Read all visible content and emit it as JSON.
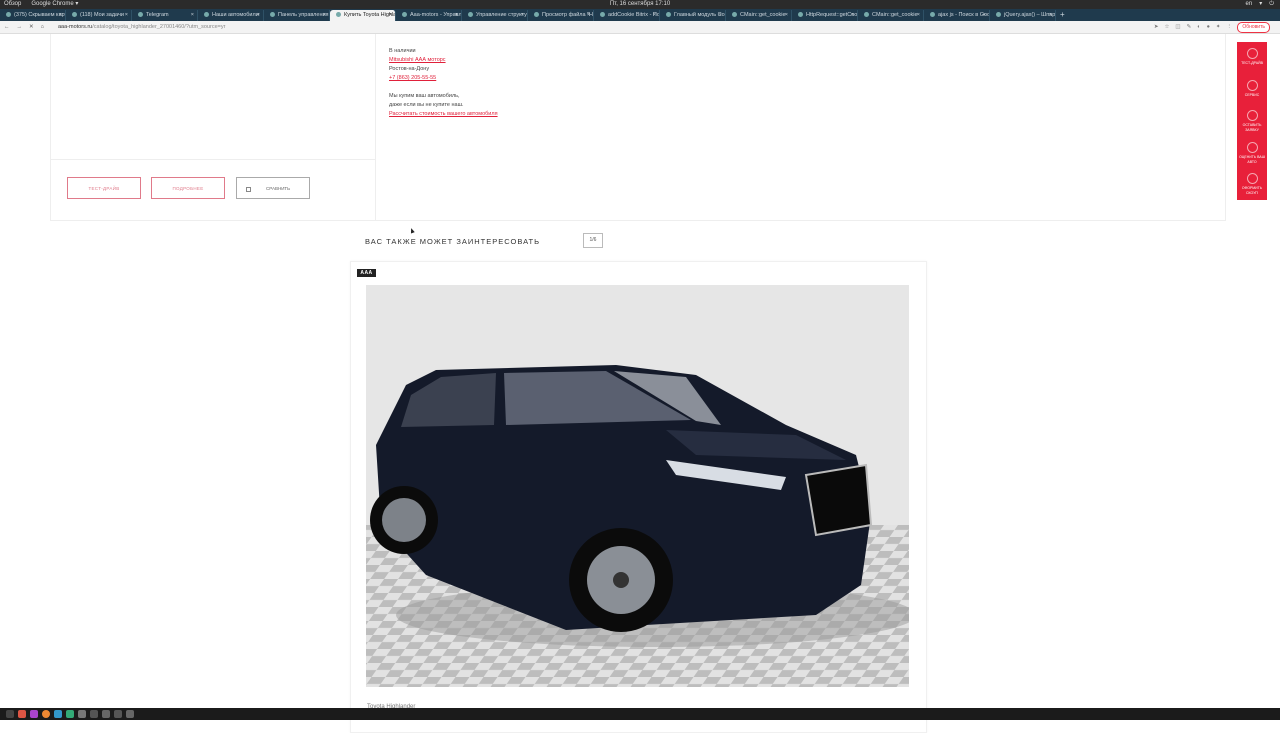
{
  "os": {
    "activities": "Обзор",
    "app": "Google Chrome ▾",
    "datetime": "Пт, 16 сентября 17:10",
    "lang": "en"
  },
  "tabs": [
    {
      "label": "(375) Скрываем карт..."
    },
    {
      "label": "(118) Мои задачи"
    },
    {
      "label": "Telegram"
    },
    {
      "label": "Наши автомобили"
    },
    {
      "label": "Панель управления"
    },
    {
      "label": "Купить Toyota Highlan...",
      "active": true
    },
    {
      "label": "Aaa-motors - Управле..."
    },
    {
      "label": "Управление структур..."
    },
    {
      "label": "Просмотр файла \"Но..."
    },
    {
      "label": "addCookie Bitrix - Пои..."
    },
    {
      "label": "Главный модуль Cont..."
    },
    {
      "label": "CMain::get_cookie"
    },
    {
      "label": "HttpRequest::getCoo..."
    },
    {
      "label": "CMain::get_cookie"
    },
    {
      "label": "ajax js - Поиск в Google"
    },
    {
      "label": "jQuery.ajax() – Шпарг..."
    }
  ],
  "address": {
    "host": "aaa-motors.ru",
    "path": "/catalog/toyota_highlander_27001460/?utm_source=yr",
    "refresh_label": "Обновить"
  },
  "info": {
    "availability": "В наличии",
    "dealer": "Mitsubishi ААА моторс",
    "city": "Ростов-на-Дону",
    "phone": "+7 (863) 205-55-55",
    "buy_line1": "Мы купим ваш автомобиль,",
    "buy_line2": "даже если вы не купите наш.",
    "calc_link": "Рассчитать стоимость вашего автомобиля"
  },
  "buttons": {
    "test_drive": "ТЕСТ-ДРАЙВ",
    "details": "ПОДРОБНЕЕ",
    "compare": "СРАВНИТЬ"
  },
  "sidebar": [
    {
      "label": "ТЕСТ-ДРАЙВ"
    },
    {
      "label": "СЕРВИС"
    },
    {
      "label": "ОСТАВИТЬ ЗАЯВКУ"
    },
    {
      "label": "ОЦЕНИТЬ ВАШ АВТО"
    },
    {
      "label": "ОФОРМИТЬ СКОУП"
    }
  ],
  "related": {
    "title": "ВАС ТАКЖЕ МОЖЕТ ЗАИНТЕРЕСОВАТЬ",
    "pager": "1/6",
    "logo": "AAA",
    "caption": "Toyota Highlander"
  }
}
